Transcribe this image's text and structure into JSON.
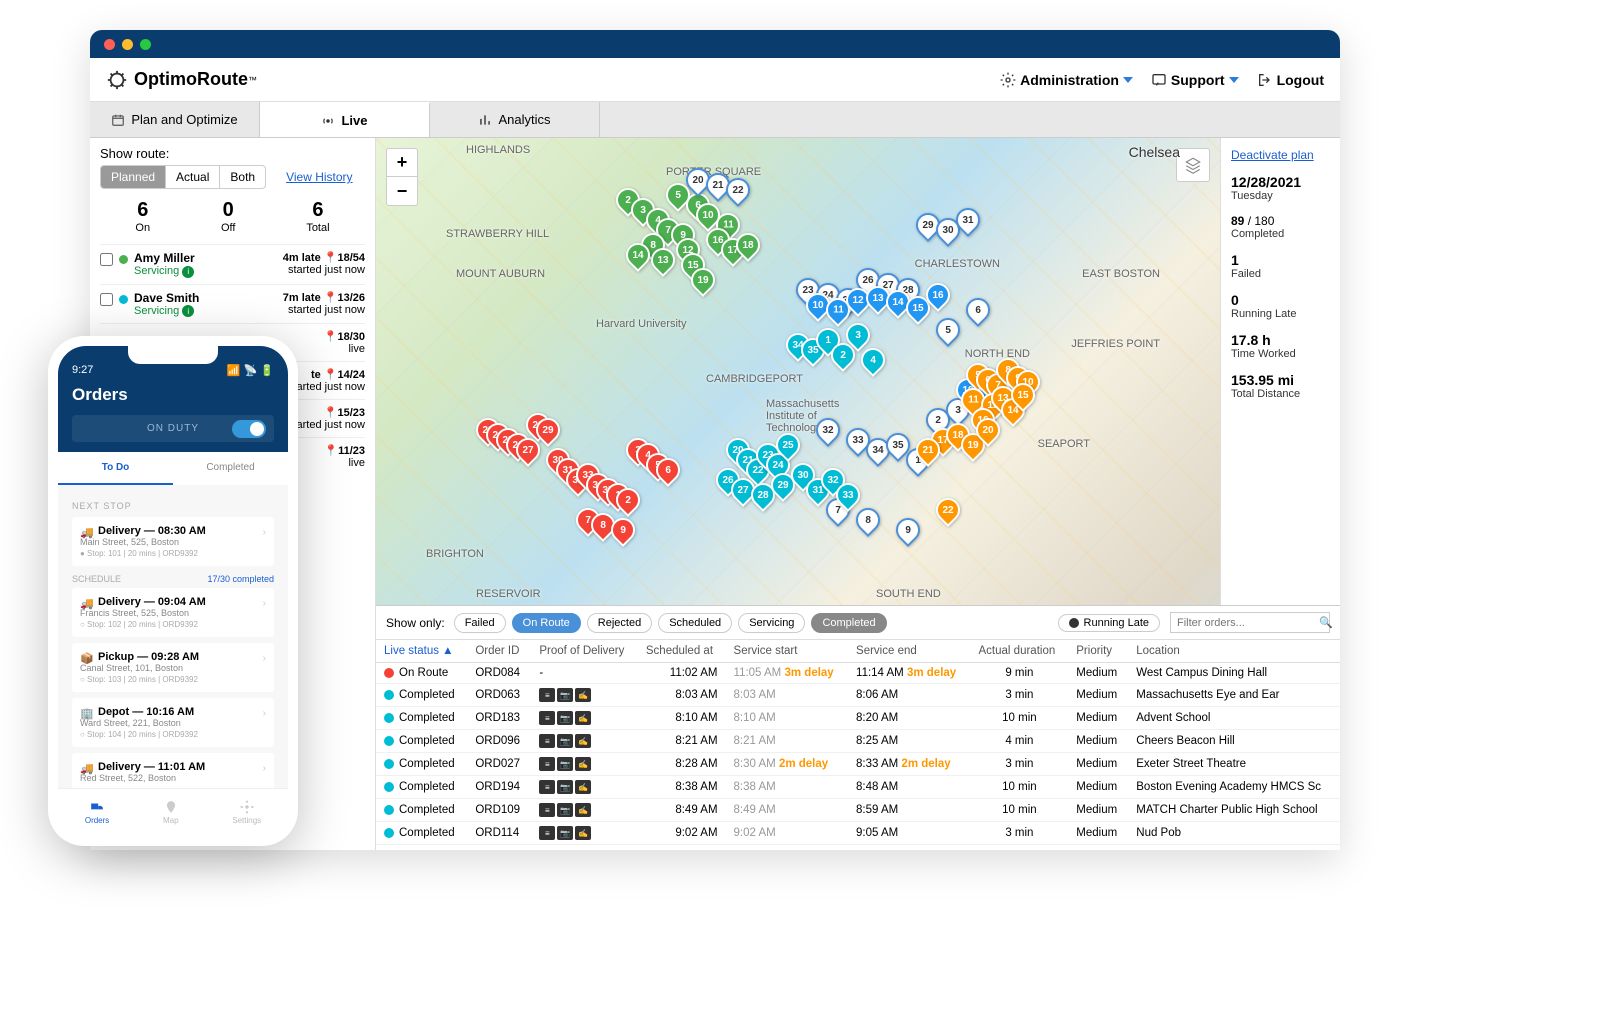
{
  "brand": "OptimoRoute",
  "topnav": {
    "admin": "Administration",
    "support": "Support",
    "logout": "Logout"
  },
  "tabs": {
    "plan": "Plan and Optimize",
    "live": "Live",
    "analytics": "Analytics"
  },
  "sidebar": {
    "show_route": "Show route:",
    "seg": {
      "planned": "Planned",
      "actual": "Actual",
      "both": "Both"
    },
    "view_history": "View History",
    "counts": {
      "on_n": "6",
      "on_t": "On",
      "off_n": "0",
      "off_t": "Off",
      "total_n": "6",
      "total_t": "Total"
    },
    "drivers": [
      {
        "name": "Amy Miller",
        "status": "Servicing",
        "late": "4m late",
        "loc": "18/54",
        "sub": "started just now",
        "color": "#4caf50"
      },
      {
        "name": "Dave Smith",
        "status": "Servicing",
        "late": "7m late",
        "loc": "13/26",
        "sub": "started just now",
        "color": "#00bcd4"
      }
    ],
    "extra": [
      {
        "loc": "18/30",
        "sub": "live"
      },
      {
        "loc": "14/24",
        "sub": "started just now",
        "late": "te"
      },
      {
        "loc": "15/23",
        "sub": "started just now"
      },
      {
        "loc": "11/23",
        "sub": "live"
      }
    ]
  },
  "map": {
    "labels": {
      "chelsea": "Chelsea",
      "highlands": "HIGHLANDS",
      "strawberry": "STRAWBERRY HILL",
      "mtauburn": "MOUNT AUBURN",
      "harvard": "Harvard University",
      "mit": "Massachusetts Institute of Technology",
      "cambridgeport": "CAMBRIDGEPORT",
      "charlestown": "CHARLESTOWN",
      "eastboston": "EAST BOSTON",
      "northend": "NORTH END",
      "jeffries": "JEFFRIES POINT",
      "seaport": "SEAPORT",
      "southend": "SOUTH END",
      "brighton": "BRIGHTON",
      "reservoir": "RESERVOIR",
      "porter": "PORTER SQUARE"
    }
  },
  "rightpanel": {
    "deactivate": "Deactivate plan",
    "date": "12/28/2021",
    "day": "Tuesday",
    "completed_v": "89",
    "completed_t": "/ 180",
    "completed_l": "Completed",
    "failed_v": "1",
    "failed_l": "Failed",
    "late_v": "0",
    "late_l": "Running Late",
    "time_v": "17.8 h",
    "time_l": "Time Worked",
    "dist_v": "153.95 mi",
    "dist_l": "Total Distance"
  },
  "filters": {
    "show_only": "Show only:",
    "chips": [
      "Failed",
      "On Route",
      "Rejected",
      "Scheduled",
      "Servicing",
      "Completed"
    ],
    "running_late": "Running Late",
    "placeholder": "Filter orders..."
  },
  "table": {
    "headers": {
      "status": "Live status",
      "order": "Order ID",
      "pod": "Proof of Delivery",
      "sched": "Scheduled at",
      "start": "Service start",
      "end": "Service end",
      "dur": "Actual duration",
      "prio": "Priority",
      "loc": "Location"
    },
    "rows": [
      {
        "st": "On Route",
        "dot": "route",
        "id": "ORD084",
        "pod": "-",
        "sched": "11:02 AM",
        "start": "11:05 AM",
        "sd": "3m delay",
        "end": "11:14 AM",
        "ed": "3m delay",
        "dur": "9 min",
        "prio": "Medium",
        "loc": "West Campus Dining Hall"
      },
      {
        "st": "Completed",
        "dot": "done",
        "id": "ORD063",
        "pod": "y",
        "sched": "8:03 AM",
        "start": "8:03 AM",
        "end": "8:06 AM",
        "dur": "3 min",
        "prio": "Medium",
        "loc": "Massachusetts Eye and Ear"
      },
      {
        "st": "Completed",
        "dot": "done",
        "id": "ORD183",
        "pod": "y",
        "sched": "8:10 AM",
        "start": "8:10 AM",
        "end": "8:20 AM",
        "dur": "10 min",
        "prio": "Medium",
        "loc": "Advent School"
      },
      {
        "st": "Completed",
        "dot": "done",
        "id": "ORD096",
        "pod": "y",
        "sched": "8:21 AM",
        "start": "8:21 AM",
        "end": "8:25 AM",
        "dur": "4 min",
        "prio": "Medium",
        "loc": "Cheers Beacon Hill"
      },
      {
        "st": "Completed",
        "dot": "done",
        "id": "ORD027",
        "pod": "y",
        "sched": "8:28 AM",
        "start": "8:30 AM",
        "sd": "2m delay",
        "end": "8:33 AM",
        "ed": "2m delay",
        "dur": "3 min",
        "prio": "Medium",
        "loc": "Exeter Street Theatre"
      },
      {
        "st": "Completed",
        "dot": "done",
        "id": "ORD194",
        "pod": "y",
        "sched": "8:38 AM",
        "start": "8:38 AM",
        "end": "8:48 AM",
        "dur": "10 min",
        "prio": "Medium",
        "loc": "Boston Evening Academy HMCS Sc"
      },
      {
        "st": "Completed",
        "dot": "done",
        "id": "ORD109",
        "pod": "y",
        "sched": "8:49 AM",
        "start": "8:49 AM",
        "end": "8:59 AM",
        "dur": "10 min",
        "prio": "Medium",
        "loc": "MATCH Charter Public High School"
      },
      {
        "st": "Completed",
        "dot": "done",
        "id": "ORD114",
        "pod": "y",
        "sched": "9:02 AM",
        "start": "9:02 AM",
        "end": "9:05 AM",
        "dur": "3 min",
        "prio": "Medium",
        "loc": "Nud Pob"
      }
    ]
  },
  "phone": {
    "time": "9:27",
    "title": "Orders",
    "duty": "ON DUTY",
    "tabs": {
      "todo": "To Do",
      "completed": "Completed"
    },
    "next_stop": "NEXT STOP",
    "schedule": "SCHEDULE",
    "sched_count": "17/30 completed",
    "items": [
      {
        "t": "Delivery — 08:30 AM",
        "a": "Main Street, 525, Boston",
        "m": "● Stop: 101  |  20 mins  |  ORD9392",
        "ic": "🚚"
      },
      {
        "t": "Delivery — 09:04 AM",
        "a": "Francis Street, 525, Boston",
        "m": "○ Stop: 102  |  20 mins  |  ORD9392",
        "ic": "🚚"
      },
      {
        "t": "Pickup — 09:28 AM",
        "a": "Canal Street, 101, Boston",
        "m": "○ Stop: 103  |  20 mins  |  ORD9392",
        "ic": "📦"
      },
      {
        "t": "Depot — 10:16 AM",
        "a": "Ward Street, 221, Boston",
        "m": "○ Stop: 104  |  20 mins  |  ORD9392",
        "ic": "🏢"
      },
      {
        "t": "Delivery — 11:01 AM",
        "a": "Red Street, 522, Boston",
        "m": "",
        "ic": "🚚"
      }
    ],
    "footer": {
      "orders": "Orders",
      "map": "Map",
      "settings": "Settings"
    }
  }
}
